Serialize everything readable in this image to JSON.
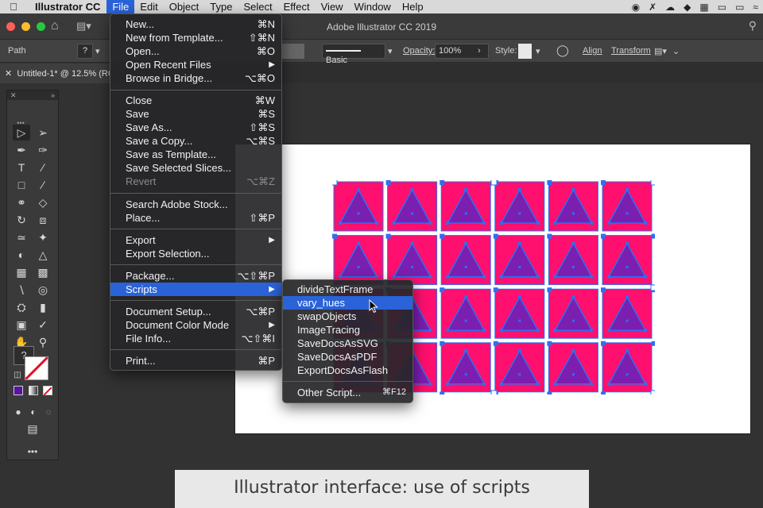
{
  "menubar": {
    "app_name": "Illustrator CC",
    "items": [
      "File",
      "Edit",
      "Object",
      "Type",
      "Select",
      "Effect",
      "View",
      "Window",
      "Help"
    ]
  },
  "window": {
    "title": "Adobe Illustrator CC 2019"
  },
  "controlbar": {
    "path_label": "Path",
    "stroke_style": "Basic",
    "opacity_label": "Opacity:",
    "opacity_value": "100%",
    "style_label": "Style:",
    "align_label": "Align",
    "transform_label": "Transform"
  },
  "tab": {
    "title": "Untitled-1* @ 12.5% (RGB"
  },
  "file_menu": {
    "items": [
      {
        "label": "New...",
        "shortcut": "⌘N"
      },
      {
        "label": "New from Template...",
        "shortcut": "⇧⌘N"
      },
      {
        "label": "Open...",
        "shortcut": "⌘O"
      },
      {
        "label": "Open Recent Files",
        "shortcut": "▶"
      },
      {
        "label": "Browse in Bridge...",
        "shortcut": "⌥⌘O"
      },
      {
        "label": "Close",
        "shortcut": "⌘W"
      },
      {
        "label": "Save",
        "shortcut": "⌘S"
      },
      {
        "label": "Save As...",
        "shortcut": "⇧⌘S"
      },
      {
        "label": "Save a Copy...",
        "shortcut": "⌥⌘S"
      },
      {
        "label": "Save as Template...",
        "shortcut": ""
      },
      {
        "label": "Save Selected Slices...",
        "shortcut": ""
      },
      {
        "label": "Revert",
        "shortcut": "⌥⌘Z"
      },
      {
        "label": "Search Adobe Stock...",
        "shortcut": ""
      },
      {
        "label": "Place...",
        "shortcut": "⇧⌘P"
      },
      {
        "label": "Export",
        "shortcut": "▶"
      },
      {
        "label": "Export Selection...",
        "shortcut": ""
      },
      {
        "label": "Package...",
        "shortcut": "⌥⇧⌘P"
      },
      {
        "label": "Scripts",
        "shortcut": "▶"
      },
      {
        "label": "Document Setup...",
        "shortcut": "⌥⌘P"
      },
      {
        "label": "Document Color Mode",
        "shortcut": "▶"
      },
      {
        "label": "File Info...",
        "shortcut": "⌥⇧⌘I"
      },
      {
        "label": "Print...",
        "shortcut": "⌘P"
      }
    ]
  },
  "scripts_menu": {
    "items": [
      {
        "label": "divideTextFrame",
        "shortcut": ""
      },
      {
        "label": "vary_hues",
        "shortcut": ""
      },
      {
        "label": "swapObjects",
        "shortcut": ""
      },
      {
        "label": "ImageTracing",
        "shortcut": ""
      },
      {
        "label": "SaveDocsAsSVG",
        "shortcut": ""
      },
      {
        "label": "SaveDocsAsPDF",
        "shortcut": ""
      },
      {
        "label": "ExportDocsAsFlash",
        "shortcut": ""
      },
      {
        "label": "Other Script...",
        "shortcut": "⌘F12"
      }
    ]
  },
  "caption": "Illustrator interface: use of scripts",
  "colors": {
    "tile_fill": "#ff0f6e",
    "triangle_fill": "#7a1fb0",
    "selection_blue": "#2f6ff0",
    "menu_highlight": "#2a63d8"
  }
}
